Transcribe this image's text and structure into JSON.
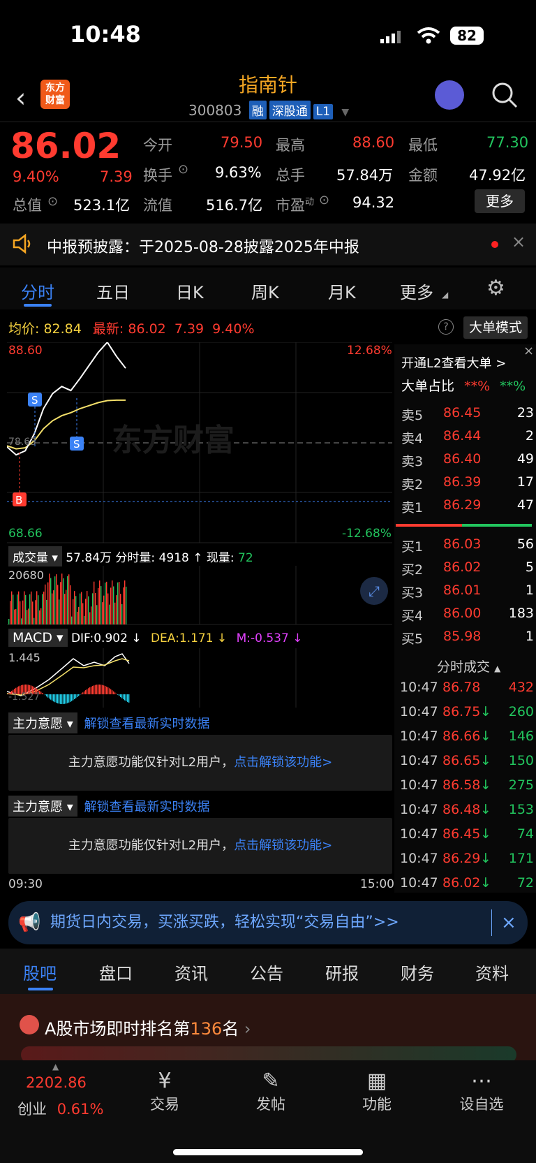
{
  "status": {
    "time": "10:48",
    "battery": "82"
  },
  "header": {
    "title": "指南针",
    "code": "300803",
    "tags": [
      "融",
      "深股通",
      "L1"
    ],
    "logo": "东方\n财富"
  },
  "quote": {
    "price": "86.02",
    "pct": "9.40%",
    "chg": "7.39",
    "open_label": "今开",
    "open": "79.50",
    "high_label": "最高",
    "high": "88.60",
    "low_label": "最低",
    "low": "77.30",
    "turn_label": "换手",
    "turn": "9.63%",
    "vol_label": "总手",
    "vol": "57.84万",
    "amt_label": "金额",
    "amt": "47.92亿",
    "mcap_label": "总值",
    "mcap": "523.1亿",
    "float_label": "流值",
    "float": "516.7亿",
    "pe_label": "市盈",
    "pe_sup": "动",
    "pe": "94.32",
    "more": "更多"
  },
  "notice": "中报预披露：于2025-08-28披露2025年中报",
  "tabs": [
    "分时",
    "五日",
    "日K",
    "周K",
    "月K",
    "更多"
  ],
  "info": {
    "avg_label": "均价:",
    "avg": "82.84",
    "last_label": "最新:",
    "last": "86.02",
    "chg": "7.39",
    "pct": "9.40%",
    "mode": "大单模式"
  },
  "chart": {
    "ymax": "88.60",
    "ymin": "68.66",
    "pmax": "12.68%",
    "pmin": "-12.68%",
    "ref": "78.63",
    "start": "09:30",
    "end": "15:00",
    "vol_max": "20680",
    "macd_max": "1.445",
    "macd_min": "-1.527"
  },
  "chart_data": {
    "type": "line",
    "series": [
      {
        "values": [
          78.2,
          77.4,
          77.8,
          79.5,
          82.0,
          83.5,
          84.2,
          83.8,
          85.0,
          86.3,
          87.6,
          88.6,
          87.2,
          86.02
        ]
      },
      {
        "values": [
          78.3,
          78.0,
          78.1,
          78.8,
          80.0,
          80.8,
          81.3,
          81.6,
          82.0,
          82.3,
          82.6,
          82.8,
          82.84,
          82.84
        ]
      }
    ]
  },
  "vol_bar": {
    "label": "成交量",
    "vol": "57.84万",
    "fs_label": "分时量:",
    "fs": "4918",
    "arrow": "↑",
    "now_label": "现量:",
    "now": "72"
  },
  "macd": {
    "label": "MACD",
    "dif": "DIF:0.902 ↓",
    "dea": "DEA:1.171 ↓",
    "m": "M:-0.537 ↓"
  },
  "l2": {
    "title": "主力意愿",
    "unlock": "解锁查看最新实时数据",
    "msg": "主力意愿功能仅针对L2用户，",
    "link": "点击解锁该功能>"
  },
  "orderbook": {
    "open_l2": "开通L2查看大单 >",
    "ratio_label": "大单占比",
    "r1": "**%",
    "r2": "**%",
    "asks": [
      {
        "l": "卖5",
        "p": "86.45",
        "v": "23"
      },
      {
        "l": "卖4",
        "p": "86.44",
        "v": "2"
      },
      {
        "l": "卖3",
        "p": "86.40",
        "v": "49"
      },
      {
        "l": "卖2",
        "p": "86.39",
        "v": "17"
      },
      {
        "l": "卖1",
        "p": "86.29",
        "v": "47"
      }
    ],
    "bids": [
      {
        "l": "买1",
        "p": "86.03",
        "v": "56"
      },
      {
        "l": "买2",
        "p": "86.02",
        "v": "5"
      },
      {
        "l": "买3",
        "p": "86.01",
        "v": "1"
      },
      {
        "l": "买4",
        "p": "86.00",
        "v": "183"
      },
      {
        "l": "买5",
        "p": "85.98",
        "v": "1"
      }
    ]
  },
  "ticks": {
    "title": "分时成交",
    "rows": [
      {
        "t": "10:47",
        "p": "86.78",
        "a": "",
        "v": "432"
      },
      {
        "t": "10:47",
        "p": "86.75",
        "a": "↓",
        "v": "260"
      },
      {
        "t": "10:47",
        "p": "86.66",
        "a": "↓",
        "v": "146"
      },
      {
        "t": "10:47",
        "p": "86.65",
        "a": "↓",
        "v": "150"
      },
      {
        "t": "10:47",
        "p": "86.58",
        "a": "↓",
        "v": "275"
      },
      {
        "t": "10:47",
        "p": "86.48",
        "a": "↓",
        "v": "153"
      },
      {
        "t": "10:47",
        "p": "86.45",
        "a": "↓",
        "v": "74"
      },
      {
        "t": "10:47",
        "p": "86.29",
        "a": "↓",
        "v": "171"
      },
      {
        "t": "10:47",
        "p": "86.02",
        "a": "↓",
        "v": "72"
      }
    ]
  },
  "ad": "期货日内交易，买涨买跌，轻松实现“交易自由”>>",
  "subtabs": [
    "股吧",
    "盘口",
    "资讯",
    "公告",
    "研报",
    "财务",
    "资料"
  ],
  "rank": {
    "text": "A股市场即时排名第",
    "num": "136",
    "suffix": "名"
  },
  "bottom": {
    "index_val": "2202.86",
    "index_name": "创业",
    "index_pct": "0.61%",
    "items": [
      "交易",
      "发帖",
      "功能",
      "设自选"
    ]
  }
}
